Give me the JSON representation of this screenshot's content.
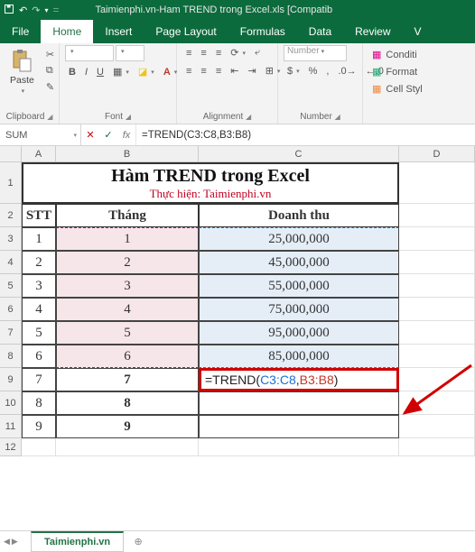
{
  "titlebar": {
    "filename": "Taimienphi.vn-Ham TREND trong Excel.xls  [Compatib"
  },
  "tabs": {
    "file": "File",
    "home": "Home",
    "insert": "Insert",
    "pagelayout": "Page Layout",
    "formulas": "Formulas",
    "data": "Data",
    "review": "Review",
    "view": "V"
  },
  "ribbon": {
    "paste": "Paste",
    "group_clipboard": "Clipboard",
    "group_font": "Font",
    "group_alignment": "Alignment",
    "group_number": "Number",
    "number_format": "Number",
    "conditional": "Conditi",
    "format_table": "Format",
    "cell_styles": "Cell Styl"
  },
  "formulabar": {
    "namebox": "SUM",
    "fx": "fx",
    "formula": "=TREND(C3:C8,B3:B8)"
  },
  "cols": {
    "A": "A",
    "B": "B",
    "C": "C",
    "D": "D"
  },
  "rows": [
    "1",
    "2",
    "3",
    "4",
    "5",
    "6",
    "7",
    "8",
    "9",
    "10",
    "11",
    "12"
  ],
  "content": {
    "title": "Hàm TREND trong Excel",
    "subtitle": "Thực hiện: Taimienphi.vn",
    "h_stt": "STT",
    "h_thang": "Tháng",
    "h_doanhthu": "Doanh thu",
    "data": [
      {
        "stt": "1",
        "thang": "1",
        "dt": "25,000,000"
      },
      {
        "stt": "2",
        "thang": "2",
        "dt": "45,000,000"
      },
      {
        "stt": "3",
        "thang": "3",
        "dt": "55,000,000"
      },
      {
        "stt": "4",
        "thang": "4",
        "dt": "75,000,000"
      },
      {
        "stt": "5",
        "thang": "5",
        "dt": "95,000,000"
      },
      {
        "stt": "6",
        "thang": "6",
        "dt": "85,000,000"
      },
      {
        "stt": "7",
        "thang": "7",
        "dt": ""
      },
      {
        "stt": "8",
        "thang": "8",
        "dt": ""
      },
      {
        "stt": "9",
        "thang": "9",
        "dt": ""
      }
    ],
    "formula_eq": "=TREND(",
    "formula_r1": "C3:C8",
    "formula_comma": ",",
    "formula_r2": "B3:B8",
    "formula_close": ")"
  },
  "sheet": {
    "name": "Taimienphi.vn"
  }
}
